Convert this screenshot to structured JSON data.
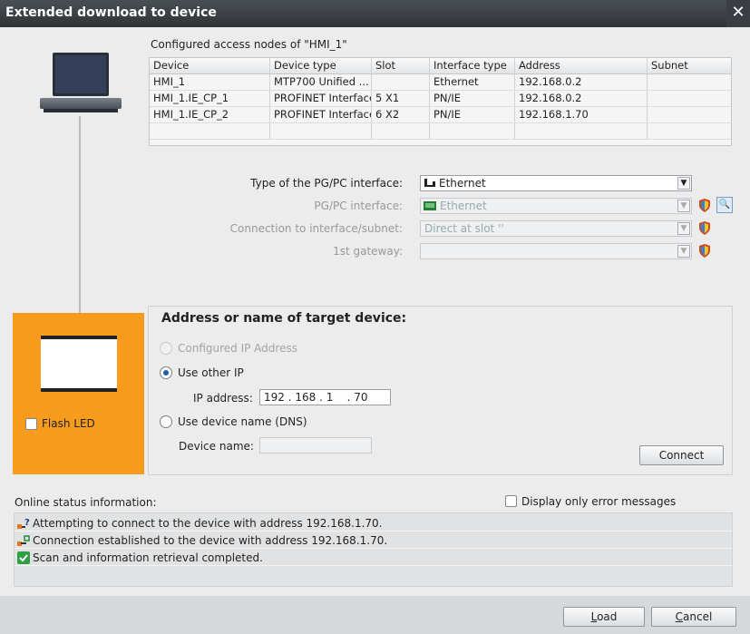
{
  "window": {
    "title": "Extended download to device",
    "close_glyph": "✕"
  },
  "nodes_table": {
    "caption": "Configured access nodes of \"HMI_1\"",
    "columns": [
      "Device",
      "Device type",
      "Slot",
      "Interface type",
      "Address",
      "Subnet"
    ],
    "rows": [
      [
        "HMI_1",
        "MTP700 Unified ...",
        "",
        "Ethernet",
        "192.168.0.2",
        ""
      ],
      [
        "HMI_1.IE_CP_1",
        "PROFINET Interface",
        "5 X1",
        "PN/IE",
        "192.168.0.2",
        ""
      ],
      [
        "HMI_1.IE_CP_2",
        "PROFINET Interface",
        "6 X2",
        "PN/IE",
        "192.168.1.70",
        ""
      ],
      [
        "",
        "",
        "",
        "",
        "",
        ""
      ]
    ]
  },
  "interface": {
    "type_label": "Type of the PG/PC interface:",
    "type_value": "Ethernet",
    "pgpc_label": "PG/PC interface:",
    "pgpc_value": "Ethernet",
    "connection_label": "Connection to interface/subnet:",
    "connection_value": "Direct at slot ''",
    "gateway_label": "1st gateway:",
    "gateway_value": ""
  },
  "target": {
    "heading": "Address or name of target device:",
    "configured_ip_label": "Configured IP Address",
    "use_other_ip_label": "Use other IP",
    "ip_address_label": "IP address:",
    "ip_address_value": "192 . 168 . 1    . 70",
    "use_dns_label": "Use device name (DNS)",
    "device_name_label": "Device name:",
    "device_name_value": "",
    "connect_button": "Connect",
    "selected_option": "use_other_ip"
  },
  "device_panel": {
    "flash_led_label": "Flash LED",
    "flash_led_checked": false,
    "panel_color": "#f99b1c"
  },
  "status": {
    "heading": "Online status information:",
    "error_only_label": "Display only error messages",
    "error_only_checked": false,
    "messages": [
      {
        "icon": "connecting-icon",
        "text": "Attempting to connect to the device with address 192.168.1.70."
      },
      {
        "icon": "connected-icon",
        "text": "Connection established to the device with address 192.168.1.70."
      },
      {
        "icon": "check-icon",
        "text": "Scan and information retrieval completed."
      }
    ]
  },
  "footer": {
    "load_button": "Load",
    "load_mnemonic": "L",
    "load_rest": "oad",
    "cancel_button": "Cancel",
    "cancel_mnemonic": "C",
    "cancel_rest": "ancel"
  }
}
